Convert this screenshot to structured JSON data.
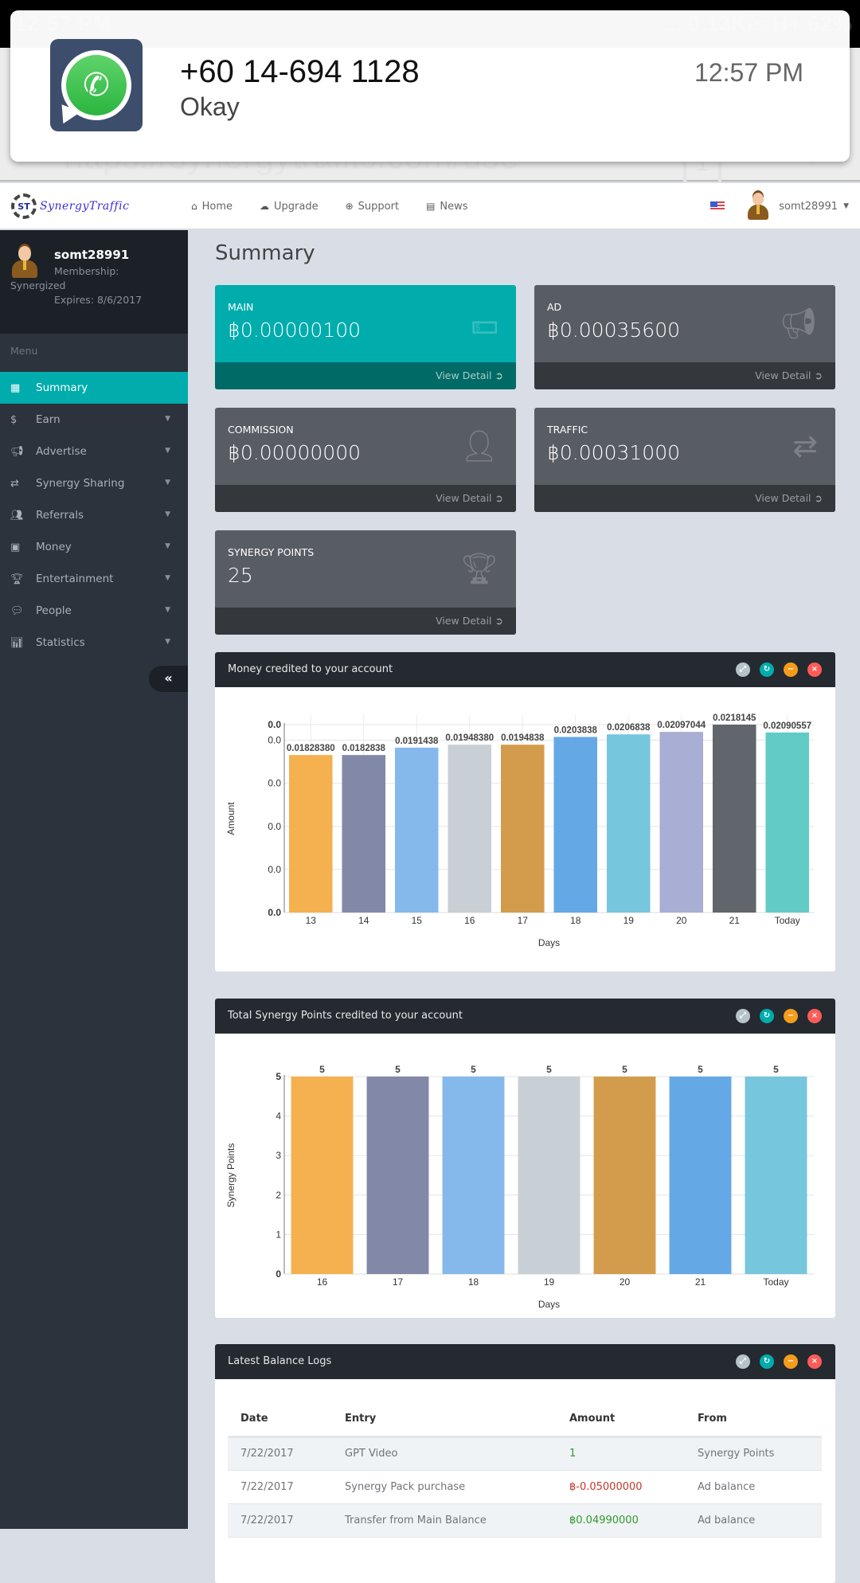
{
  "status_bar": {
    "time": "12:57 PM",
    "right": "... 0.13K/s  H+  62%"
  },
  "browser": {
    "url": "https://synergytraffic.com/use",
    "tab_count": "1"
  },
  "notification": {
    "app": "WhatsApp",
    "sender": "+60 14-694 1128",
    "message": "Okay",
    "time": "12:57 PM"
  },
  "topnav": {
    "brand": "SynergyTraffic",
    "brand_badge": "ST",
    "links": [
      {
        "label": "Home",
        "icon": "home-icon"
      },
      {
        "label": "Upgrade",
        "icon": "cloud-upload-icon"
      },
      {
        "label": "Support",
        "icon": "life-ring-icon"
      },
      {
        "label": "News",
        "icon": "newspaper-icon"
      }
    ],
    "username": "somt28991"
  },
  "sidebar": {
    "profile": {
      "name": "somt28991",
      "membership_label": "Membership:",
      "membership_value": "Synergized",
      "expires": "Expires: 8/6/2017"
    },
    "menu_label": "Menu",
    "items": [
      {
        "label": "Summary",
        "icon": "dashboard-icon",
        "active": true
      },
      {
        "label": "Earn",
        "icon": "dollar-icon"
      },
      {
        "label": "Advertise",
        "icon": "bullhorn-icon"
      },
      {
        "label": "Synergy Sharing",
        "icon": "exchange-icon"
      },
      {
        "label": "Referrals",
        "icon": "users-icon"
      },
      {
        "label": "Money",
        "icon": "money-icon"
      },
      {
        "label": "Entertainment",
        "icon": "trophy-icon"
      },
      {
        "label": "People",
        "icon": "comments-icon"
      },
      {
        "label": "Statistics",
        "icon": "bar-chart-icon"
      }
    ],
    "collapse_label": "«"
  },
  "main": {
    "title": "Summary",
    "stats": [
      {
        "label": "MAIN",
        "value": "฿0.00000100",
        "icon": "money-icon",
        "footer": "View Detail"
      },
      {
        "label": "AD",
        "value": "฿0.00035600",
        "icon": "bullhorn-icon",
        "footer": "View Detail"
      },
      {
        "label": "COMMISSION",
        "value": "฿0.00000000",
        "icon": "user-icon",
        "footer": "View Detail"
      },
      {
        "label": "TRAFFIC",
        "value": "฿0.00031000",
        "icon": "exchange-icon",
        "footer": "View Detail"
      },
      {
        "label": "SYNERGY POINTS",
        "value": "25",
        "icon": "trophy-icon",
        "footer": "View Detail"
      }
    ],
    "panels": {
      "money": {
        "title": "Money credited to your account"
      },
      "points": {
        "title": "Total Synergy Points credited to your account"
      },
      "logs": {
        "title": "Latest Balance Logs",
        "columns": [
          "Date",
          "Entry",
          "Amount",
          "From"
        ],
        "rows": [
          {
            "date": "7/22/2017",
            "entry": "GPT Video",
            "amount": "1",
            "sign": "pos",
            "from": "Synergy Points"
          },
          {
            "date": "7/22/2017",
            "entry": "Synergy Pack purchase",
            "amount": "฿-0.05000000",
            "sign": "neg",
            "from": "Ad balance"
          },
          {
            "date": "7/22/2017",
            "entry": "Transfer from Main Balance",
            "amount": "฿0.04990000",
            "sign": "pos",
            "from": "Ad balance"
          }
        ]
      }
    },
    "panel_buttons": [
      "expand",
      "reload",
      "collapse",
      "remove"
    ]
  },
  "chart_data": [
    {
      "type": "bar",
      "title": "Money credited to your account",
      "xlabel": "Days",
      "ylabel": "Amount",
      "categories": [
        "13",
        "14",
        "15",
        "16",
        "17",
        "18",
        "19",
        "20",
        "21",
        "Today"
      ],
      "values": [
        0.0182838,
        0.0182838,
        0.0191438,
        0.0194838,
        0.0194838,
        0.0203838,
        0.0206838,
        0.02097044,
        0.0218145,
        0.02090557
      ],
      "value_labels": [
        "0.01828380",
        "0.0182838",
        "0.0191438",
        "0.01948380",
        "0.0194838",
        "0.0203838",
        "0.0206838",
        "0.02097044",
        "0.0218145",
        "0.02090557"
      ],
      "ytick_values": [
        0,
        0.005,
        0.01,
        0.015,
        0.02,
        0.0218145
      ],
      "ytick_labels": [
        "0.0",
        "0.0",
        "0.0",
        "0.0",
        "0.0",
        "0.0"
      ],
      "ylim": [
        0,
        0.0218145
      ],
      "grid": true,
      "colors": [
        "#f5b14f",
        "#8288a8",
        "#85b9ec",
        "#c8cfd5",
        "#d39c4c",
        "#65a8e6",
        "#76c6de",
        "#a9aed4",
        "#61656c",
        "#63cbc5"
      ]
    },
    {
      "type": "bar",
      "title": "Total Synergy Points credited to your account",
      "xlabel": "Days",
      "ylabel": "Synergy Points",
      "categories": [
        "16",
        "17",
        "18",
        "19",
        "20",
        "21",
        "Today"
      ],
      "values": [
        5,
        5,
        5,
        5,
        5,
        5,
        5
      ],
      "value_labels": [
        "5",
        "5",
        "5",
        "5",
        "5",
        "5",
        "5"
      ],
      "ytick_values": [
        0,
        1,
        2,
        3,
        4,
        5
      ],
      "ytick_labels": [
        "0",
        "1",
        "2",
        "3",
        "4",
        "5"
      ],
      "ylim": [
        0,
        5
      ],
      "grid": true,
      "colors": [
        "#f5b14f",
        "#8288a8",
        "#85b9ec",
        "#c8cfd5",
        "#d39c4c",
        "#65a8e6",
        "#76c6de"
      ]
    }
  ]
}
